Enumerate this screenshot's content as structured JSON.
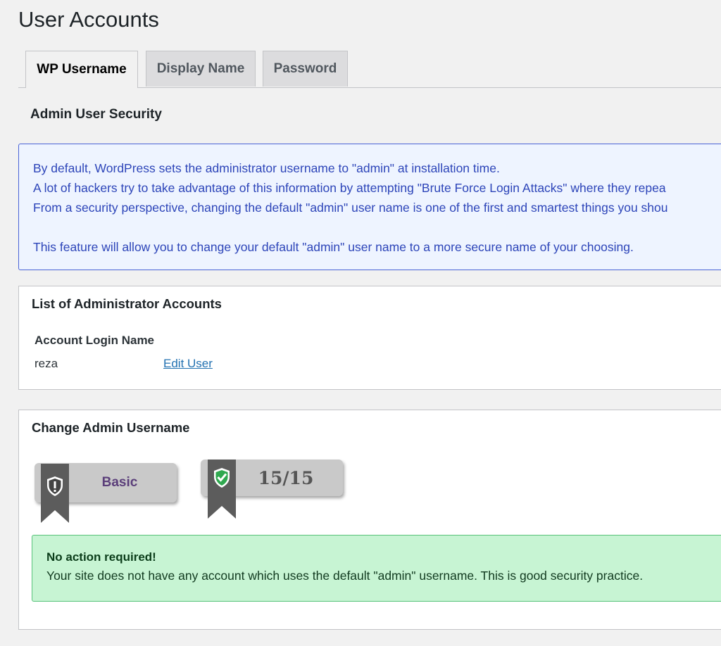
{
  "page": {
    "title": "User Accounts"
  },
  "tabs": [
    {
      "label": "WP Username",
      "active": true
    },
    {
      "label": "Display Name",
      "active": false
    },
    {
      "label": "Password",
      "active": false
    }
  ],
  "admin_security": {
    "title": "Admin User Security",
    "info_lines": [
      "By default, WordPress sets the administrator username to \"admin\" at installation time.",
      "A lot of hackers try to take advantage of this information by attempting \"Brute Force Login Attacks\" where they repea",
      "From a security perspective, changing the default \"admin\" user name is one of the first and smartest things you shou",
      "This feature will allow you to change your default \"admin\" user name to a more secure name of your choosing."
    ]
  },
  "admin_list": {
    "title": "List of Administrator Accounts",
    "column_header": "Account Login Name",
    "rows": [
      {
        "login": "reza",
        "action": "Edit User"
      }
    ]
  },
  "change_username": {
    "title": "Change Admin Username",
    "level_badge": "Basic",
    "score_badge": "15/15",
    "success_title": "No action required!",
    "success_message": "Your site does not have any account which uses the default \"admin\" username. This is good security practice."
  },
  "colors": {
    "info_text": "#2d45b9",
    "info_bg": "#eef4ff",
    "success_bg": "#c7f4d3",
    "success_border": "#58c27a",
    "link": "#2271b1"
  },
  "icons": {
    "basic_badge": "shield-exclamation-icon",
    "score_badge": "shield-check-icon"
  }
}
